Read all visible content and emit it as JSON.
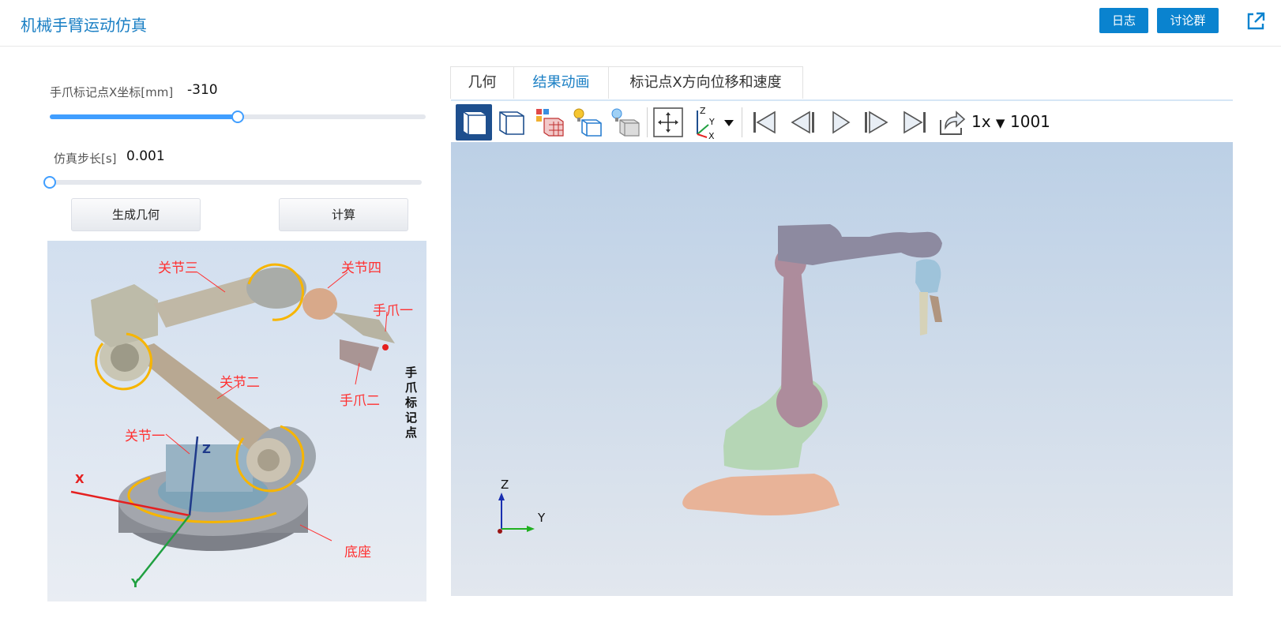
{
  "header": {
    "title": "机械手臂运动仿真",
    "log_button": "日志",
    "discussion_button": "讨论群"
  },
  "params": {
    "x_coord_label": "手爪标记点X坐标[mm]",
    "x_coord_value": "-310",
    "x_coord_slider_fraction": 0.5,
    "step_label": "仿真步长[s]",
    "step_value": "0.001",
    "step_slider_fraction": 0.0
  },
  "actions": {
    "generate_geometry": "生成几何",
    "calculate": "计算"
  },
  "reference_figure": {
    "labels": {
      "joint1": "关节一",
      "joint2": "关节二",
      "joint3": "关节三",
      "joint4": "关节四",
      "gripper1": "手爪一",
      "gripper2": "手爪二",
      "marker": "手爪标记点",
      "base": "底座",
      "axis_x": "X",
      "axis_y": "Y",
      "axis_z": "Z"
    }
  },
  "tabs": [
    {
      "label": "几何",
      "active": false
    },
    {
      "label": "结果动画",
      "active": true
    },
    {
      "label": "标记点X方向位移和速度",
      "active": false
    }
  ],
  "toolbar": {
    "speed": "1x",
    "frame": "1001",
    "icons": [
      "solid-view-icon",
      "wireframe-view-icon",
      "mesh-view-icon",
      "light-wireframe-icon",
      "light-solid-icon",
      "fit-view-icon",
      "axis-triad-icon",
      "first-frame-icon",
      "previous-frame-icon",
      "play-icon",
      "next-frame-icon",
      "last-frame-icon",
      "export-icon"
    ]
  },
  "viewport": {
    "axis_y": "Y",
    "axis_z": "Z"
  },
  "colors": {
    "accent": "#0a83cf",
    "title": "#1a7fc4",
    "slider": "#409eff",
    "label_red": "#ff3030"
  }
}
